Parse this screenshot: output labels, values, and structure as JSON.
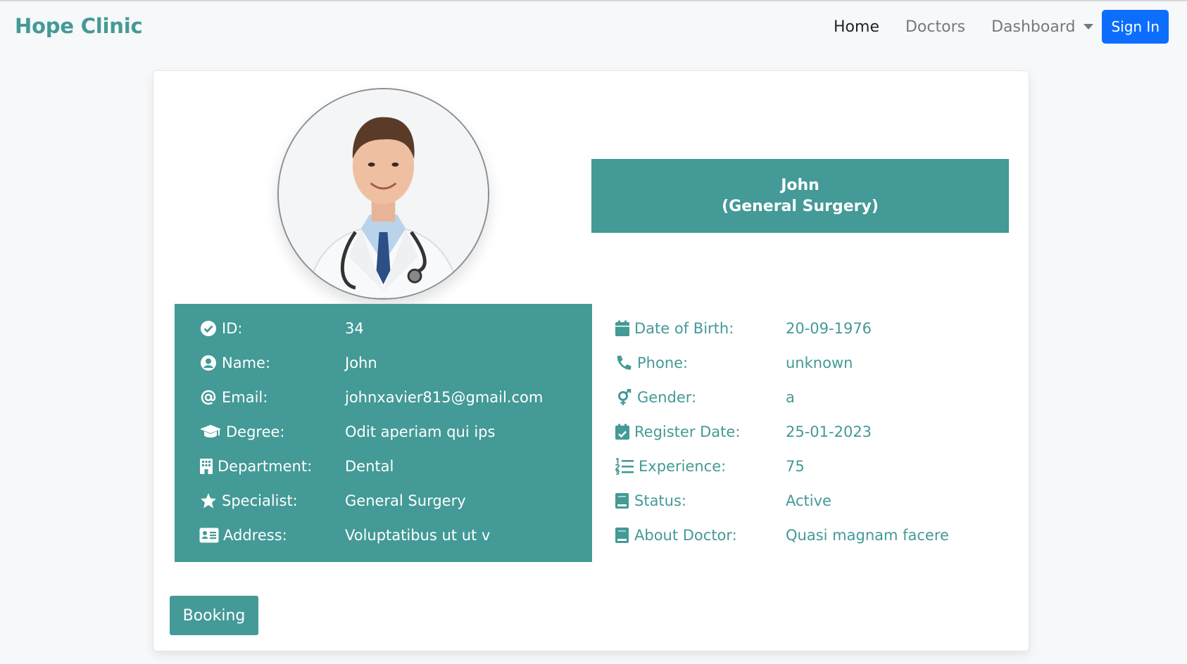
{
  "navbar": {
    "brand": "Hope Clinic",
    "links": [
      {
        "label": "Home",
        "active": true
      },
      {
        "label": "Doctors",
        "active": false
      },
      {
        "label": "Dashboard",
        "active": false
      }
    ],
    "signin_label": "Sign In"
  },
  "profile": {
    "avatar_alt": "Doctor portrait",
    "banner_name": "John",
    "banner_specialty": "(General Surgery)",
    "left_fields": [
      {
        "icon": "check-circle-icon",
        "label": "ID:",
        "value": "34"
      },
      {
        "icon": "user-circle-icon",
        "label": "Name:",
        "value": "John"
      },
      {
        "icon": "at-icon",
        "label": "Email:",
        "value": "johnxavier815@gmail.com"
      },
      {
        "icon": "graduation-cap-icon",
        "label": "Degree:",
        "value": "Odit aperiam qui ips"
      },
      {
        "icon": "building-icon",
        "label": "Department:",
        "value": "Dental"
      },
      {
        "icon": "star-icon",
        "label": "Specialist:",
        "value": "General Surgery"
      },
      {
        "icon": "address-card-icon",
        "label": "Address:",
        "value": "Voluptatibus ut ut v"
      }
    ],
    "right_fields": [
      {
        "icon": "calendar-icon",
        "label": "Date of Birth:",
        "value": "20-09-1976"
      },
      {
        "icon": "phone-icon",
        "label": "Phone:",
        "value": "unknown"
      },
      {
        "icon": "gender-icon",
        "label": "Gender:",
        "value": "a"
      },
      {
        "icon": "calendar-check-icon",
        "label": "Register Date:",
        "value": "25-01-2023"
      },
      {
        "icon": "list-ol-icon",
        "label": "Experience:",
        "value": "75"
      },
      {
        "icon": "book-icon",
        "label": "Status:",
        "value": "Active"
      },
      {
        "icon": "book-icon",
        "label": "About Doctor:",
        "value": "Quasi magnam facere"
      }
    ]
  },
  "booking_label": "Booking",
  "colors": {
    "brand": "#439a96",
    "primary_button": "#0d6efd",
    "page_bg": "#f7f8fa"
  }
}
